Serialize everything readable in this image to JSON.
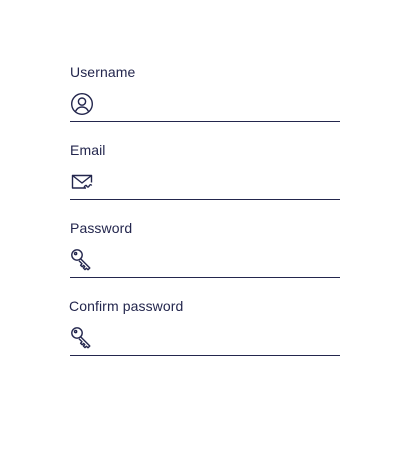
{
  "form": {
    "fields": [
      {
        "label": "Username",
        "value": "",
        "placeholder": "",
        "icon": "user-circle-icon"
      },
      {
        "label": "Email",
        "value": "",
        "placeholder": "",
        "icon": "envelope-icon"
      },
      {
        "label": "Password",
        "value": "",
        "placeholder": "",
        "icon": "key-icon"
      },
      {
        "label": "Confirm password",
        "value": "",
        "placeholder": "",
        "icon": "key-icon"
      }
    ]
  },
  "colors": {
    "text": "#23264d",
    "underline": "#23264d",
    "background": "#ffffff"
  }
}
